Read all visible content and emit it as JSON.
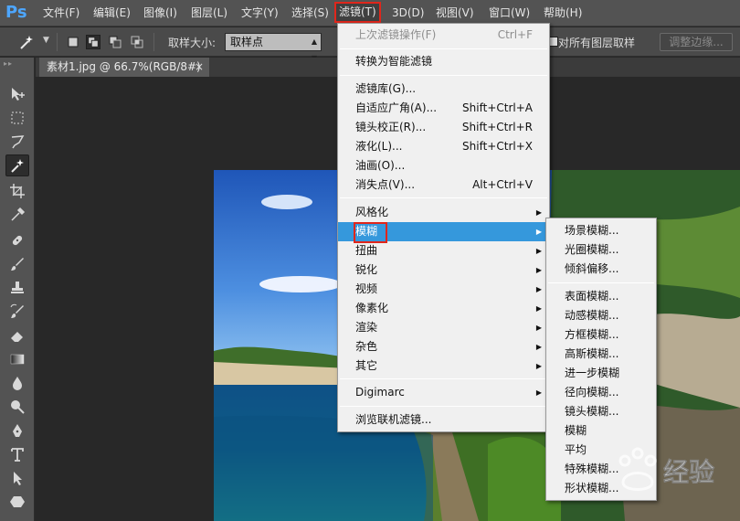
{
  "app": {
    "logo": "Ps"
  },
  "menubar": {
    "items": [
      {
        "label": "文件(F)"
      },
      {
        "label": "编辑(E)"
      },
      {
        "label": "图像(I)"
      },
      {
        "label": "图层(L)"
      },
      {
        "label": "文字(Y)"
      },
      {
        "label": "选择(S)"
      },
      {
        "label": "滤镜(T)",
        "active": true
      },
      {
        "label": "3D(D)"
      },
      {
        "label": "视图(V)"
      },
      {
        "label": "窗口(W)"
      },
      {
        "label": "帮助(H)"
      }
    ]
  },
  "options_bar": {
    "tool_icon": "magic-wand-icon",
    "sample_size_label": "取样大小:",
    "sample_size_value": "取样点",
    "sample_all_layers_label": "对所有图层取样",
    "refine_edge_button": "调整边缘..."
  },
  "tools": [
    {
      "name": "move-tool-icon"
    },
    {
      "name": "marquee-tool-icon"
    },
    {
      "name": "lasso-tool-icon"
    },
    {
      "name": "magic-wand-tool-icon",
      "selected": true
    },
    {
      "name": "crop-tool-icon"
    },
    {
      "name": "eyedropper-tool-icon"
    },
    {
      "name": "healing-brush-tool-icon"
    },
    {
      "name": "brush-tool-icon"
    },
    {
      "name": "clone-stamp-tool-icon"
    },
    {
      "name": "history-brush-tool-icon"
    },
    {
      "name": "eraser-tool-icon"
    },
    {
      "name": "gradient-tool-icon"
    },
    {
      "name": "blur-tool-icon"
    },
    {
      "name": "dodge-tool-icon"
    },
    {
      "name": "pen-tool-icon"
    },
    {
      "name": "type-tool-icon"
    },
    {
      "name": "path-selection-tool-icon"
    },
    {
      "name": "shape-tool-icon"
    }
  ],
  "document": {
    "tab_title": "素材1.jpg @ 66.7%(RGB/8#)",
    "close_glyph": "×"
  },
  "filter_menu": {
    "items": [
      {
        "label": "上次滤镜操作(F)",
        "shortcut": "Ctrl+F",
        "disabled": true
      },
      {
        "label": "转换为智能滤镜"
      },
      {
        "label": "滤镜库(G)..."
      },
      {
        "label": "自适应广角(A)...",
        "shortcut": "Shift+Ctrl+A"
      },
      {
        "label": "镜头校正(R)...",
        "shortcut": "Shift+Ctrl+R"
      },
      {
        "label": "液化(L)...",
        "shortcut": "Shift+Ctrl+X"
      },
      {
        "label": "油画(O)..."
      },
      {
        "label": "消失点(V)...",
        "shortcut": "Alt+Ctrl+V"
      },
      {
        "label": "风格化",
        "submenu": true
      },
      {
        "label": "模糊",
        "submenu": true,
        "highlighted": true
      },
      {
        "label": "扭曲",
        "submenu": true
      },
      {
        "label": "锐化",
        "submenu": true
      },
      {
        "label": "视频",
        "submenu": true
      },
      {
        "label": "像素化",
        "submenu": true
      },
      {
        "label": "渲染",
        "submenu": true
      },
      {
        "label": "杂色",
        "submenu": true
      },
      {
        "label": "其它",
        "submenu": true
      },
      {
        "label": "Digimarc",
        "submenu": true
      },
      {
        "label": "浏览联机滤镜..."
      }
    ]
  },
  "blur_submenu": {
    "items": [
      {
        "label": "场景模糊..."
      },
      {
        "label": "光圈模糊..."
      },
      {
        "label": "倾斜偏移..."
      },
      {
        "label": "表面模糊..."
      },
      {
        "label": "动感模糊..."
      },
      {
        "label": "方框模糊..."
      },
      {
        "label": "高斯模糊..."
      },
      {
        "label": "进一步模糊"
      },
      {
        "label": "径向模糊..."
      },
      {
        "label": "镜头模糊..."
      },
      {
        "label": "模糊"
      },
      {
        "label": "平均"
      },
      {
        "label": "特殊模糊..."
      },
      {
        "label": "形状模糊..."
      }
    ]
  },
  "watermark": {
    "text": "经验",
    "icon": "baidu-paw-icon"
  },
  "colors": {
    "highlight": "#3598dc",
    "annotation_red": "#e0261b",
    "menubar_bg": "#535353",
    "menu_bg": "#f0f0f0"
  }
}
